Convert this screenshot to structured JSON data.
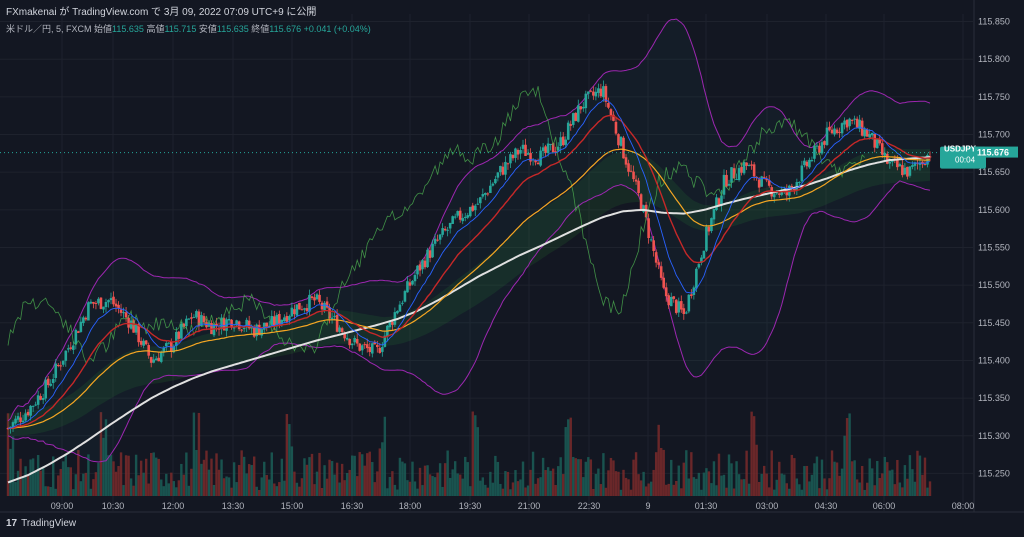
{
  "header": {
    "publish_line": "FXmakenai が TradingView.com で 3月 09, 2022 07:09 UTC+9 に公開"
  },
  "symbol_bar": {
    "symbol": "米ドル／円, 5, FXCM",
    "open_label": "始値",
    "open": "115.635",
    "high_label": "高値",
    "high": "115.715",
    "low_label": "安値",
    "low": "115.635",
    "close_label": "終値",
    "close": "115.676",
    "change": "+0.041 (+0.04%)"
  },
  "price_tag": {
    "ticker": "USDJPY",
    "price": "115.676",
    "countdown": "00:04"
  },
  "footer": {
    "logo": "17",
    "brand": "TradingView"
  },
  "colors": {
    "background": "#131722",
    "up": "#26a69a",
    "down": "#ef5350",
    "bollinger": "#9c27b0",
    "sma_long": "#e0e0e0",
    "ema_fast": "#f44336",
    "ema_mid": "#f5a623",
    "lagging_span": "#4caf50",
    "tenkan": "#2962ff"
  },
  "chart_data": {
    "type": "line",
    "title": "米ドル／円, 5, FXCM",
    "y_ticks": [
      "115.850",
      "115.800",
      "115.750",
      "115.700",
      "115.650",
      "115.600",
      "115.550",
      "115.500",
      "115.450",
      "115.400",
      "115.350",
      "115.300",
      "115.250"
    ],
    "ylim": [
      115.22,
      115.86
    ],
    "x_ticks": [
      "09:00",
      "10:30",
      "12:00",
      "13:30",
      "15:00",
      "16:30",
      "18:00",
      "19:30",
      "21:00",
      "22:30",
      "9",
      "01:30",
      "03:00",
      "04:30",
      "06:00",
      "08:00"
    ],
    "x": [
      "08:15",
      "08:45",
      "09:15",
      "09:45",
      "10:15",
      "10:45",
      "11:15",
      "11:45",
      "12:15",
      "12:45",
      "13:15",
      "13:45",
      "14:15",
      "14:45",
      "15:15",
      "15:45",
      "16:15",
      "16:45",
      "17:15",
      "17:45",
      "18:15",
      "18:45",
      "19:15",
      "19:45",
      "20:15",
      "20:45",
      "21:15",
      "21:45",
      "22:15",
      "22:45",
      "23:15",
      "23:45",
      "00:15",
      "00:45",
      "01:15",
      "01:45",
      "02:15",
      "02:45",
      "03:15",
      "03:45",
      "04:15",
      "04:45",
      "05:15",
      "05:45",
      "06:15",
      "06:45"
    ],
    "series": [
      {
        "values": [
          115.31,
          115.335,
          115.37,
          115.42,
          115.475,
          115.48,
          115.45,
          115.4,
          115.42,
          115.46,
          115.445,
          115.455,
          115.44,
          115.45,
          115.47,
          115.48,
          115.45,
          115.42,
          115.41,
          115.47,
          115.52,
          115.56,
          115.59,
          115.61,
          115.65,
          115.68,
          115.67,
          115.69,
          115.74,
          115.76,
          115.68,
          115.6,
          115.49,
          115.46,
          115.56,
          115.64,
          115.66,
          115.63,
          115.62,
          115.66,
          115.7,
          115.72,
          115.7,
          115.66,
          115.65,
          115.676
        ]
      },
      {
        "values": [
          115.238,
          115.248,
          115.262,
          115.278,
          115.296,
          115.315,
          115.333,
          115.35,
          115.364,
          115.376,
          115.386,
          115.394,
          115.402,
          115.41,
          115.418,
          115.426,
          115.433,
          115.44,
          115.447,
          115.455,
          115.466,
          115.48,
          115.496,
          115.512,
          115.526,
          115.54,
          115.552,
          115.565,
          115.578,
          115.59,
          115.598,
          115.6,
          115.596,
          115.595,
          115.6,
          115.608,
          115.615,
          115.621,
          115.627,
          115.633,
          115.642,
          115.652,
          115.66,
          115.666,
          115.668,
          115.67
        ]
      }
    ]
  }
}
